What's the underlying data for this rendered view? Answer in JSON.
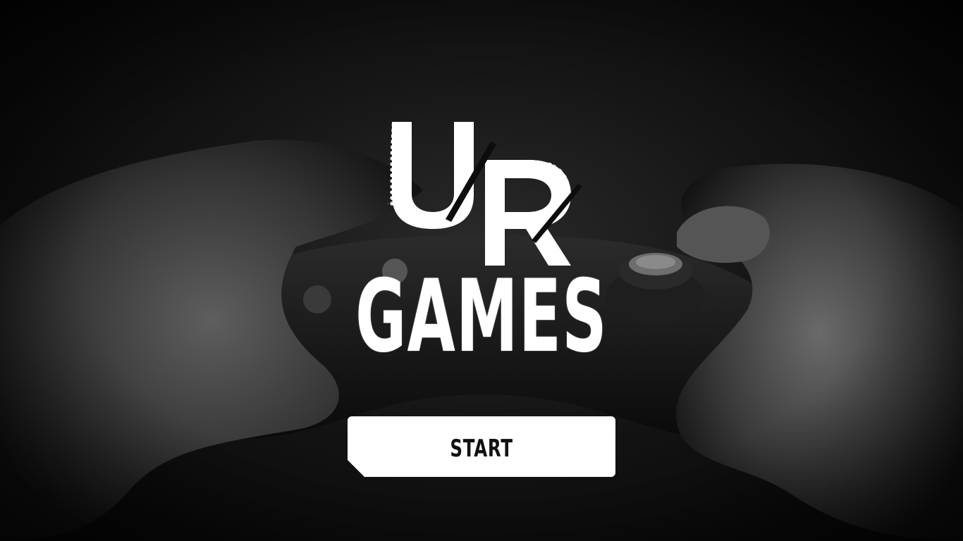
{
  "logo": {
    "monogram": "UR",
    "wordmark": "GAMES"
  },
  "start_button": {
    "label": "START"
  },
  "colors": {
    "background": "#000000",
    "logo": "#ffffff",
    "button_bg": "#ffffff",
    "button_text": "#111111"
  },
  "background_image": "hands-holding-game-controller"
}
